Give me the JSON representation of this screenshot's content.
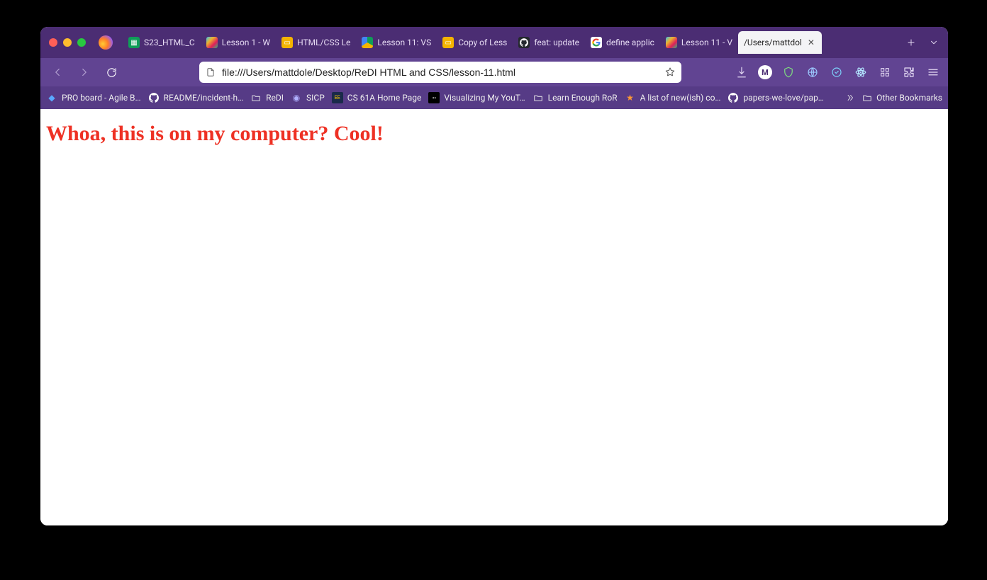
{
  "window": {
    "traffic": [
      "close",
      "minimize",
      "zoom"
    ]
  },
  "tabs": {
    "items": [
      {
        "label": "S23_HTML_C",
        "favicon": "sheets"
      },
      {
        "label": "Lesson 1 - W",
        "favicon": "slack"
      },
      {
        "label": "HTML/CSS Le",
        "favicon": "slides"
      },
      {
        "label": "Lesson 11: VS",
        "favicon": "drive"
      },
      {
        "label": "Copy of Less",
        "favicon": "slides"
      },
      {
        "label": "feat: update ",
        "favicon": "github"
      },
      {
        "label": "define applic",
        "favicon": "google"
      },
      {
        "label": "Lesson 11 - V",
        "favicon": "slack"
      },
      {
        "label": "/Users/mattdol",
        "favicon": "file",
        "active": true
      }
    ],
    "newtab": "+",
    "alltabs": "v"
  },
  "nav": {
    "back": "←",
    "forward": "→",
    "reload": "⟳",
    "url": "file:///Users/mattdole/Desktop/ReDI HTML and CSS/lesson-11.html"
  },
  "toolbar_right": {
    "download": "download-icon",
    "badge_letter": "M",
    "items": [
      "shield-icon",
      "globe-icon",
      "refresh-badge-icon",
      "react-icon",
      "grid-icon",
      "puzzle-icon",
      "menu-icon"
    ]
  },
  "bookmarks": {
    "items": [
      {
        "label": "PRO board - Agile B…",
        "icon": "diamond"
      },
      {
        "label": "README/incident-h…",
        "icon": "github"
      },
      {
        "label": "ReDI",
        "icon": "folder"
      },
      {
        "label": "SICP",
        "icon": "sphere"
      },
      {
        "label": "CS 61A Home Page",
        "icon": "eecs"
      },
      {
        "label": "Visualizing My YouT…",
        "icon": "medium"
      },
      {
        "label": "Learn Enough RoR",
        "icon": "folder"
      },
      {
        "label": "A list of new(ish) co…",
        "icon": "star"
      },
      {
        "label": "papers-we-love/pap…",
        "icon": "github"
      }
    ],
    "overflow": "»",
    "other": "Other Bookmarks"
  },
  "page": {
    "heading": "Whoa, this is on my computer? Cool!"
  },
  "colors": {
    "tabstrip": "#4b2d73",
    "toolbar": "#614492",
    "bookmarks": "#563b86",
    "heading": "#ee3124"
  }
}
